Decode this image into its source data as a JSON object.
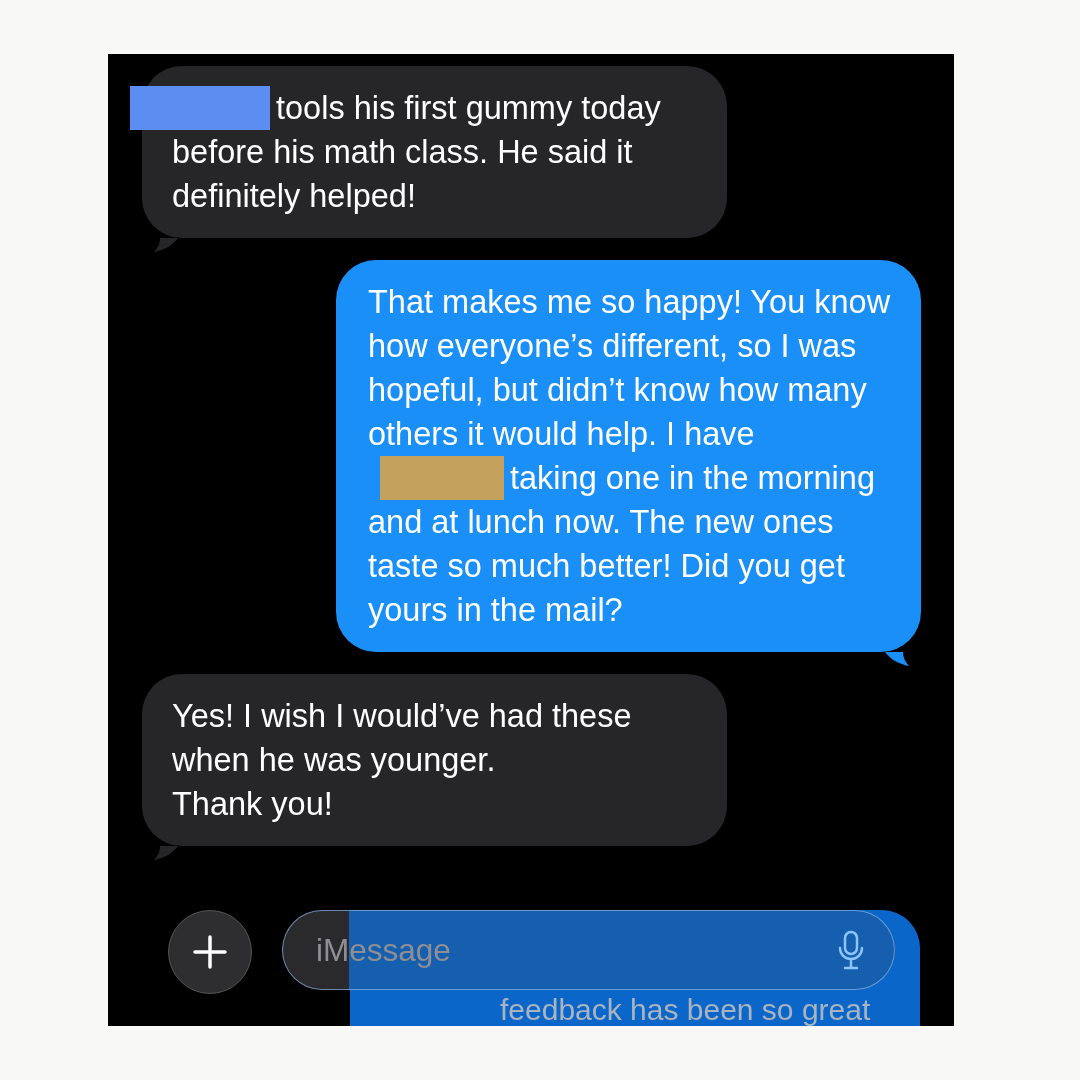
{
  "messages": [
    {
      "kind": "incoming",
      "segments": [
        {
          "kind": "redaction",
          "color": "#5b8ef0"
        },
        {
          "kind": "text",
          "text": "tools his first gummy today before his math class. He said it definitely helped!"
        }
      ]
    },
    {
      "kind": "outgoing",
      "segments": [
        {
          "kind": "text",
          "text": "That makes me so happy! You know how everyone’s different, so I was hopeful, but didn’t know how many others it would help. I have"
        },
        {
          "kind": "redaction",
          "color": "#c4a25e"
        },
        {
          "kind": "text",
          "text": "taking one in the morning and at lunch now. The new ones taste so much better! Did you get yours in the mail?"
        }
      ]
    },
    {
      "kind": "incoming",
      "segments": [
        {
          "kind": "text",
          "text": "Yes! I wish I would’ve had these when he was younger.\nThank you!"
        }
      ]
    }
  ],
  "composer": {
    "placeholder": "iMessage",
    "underlying_text": "feedback has been so great"
  }
}
